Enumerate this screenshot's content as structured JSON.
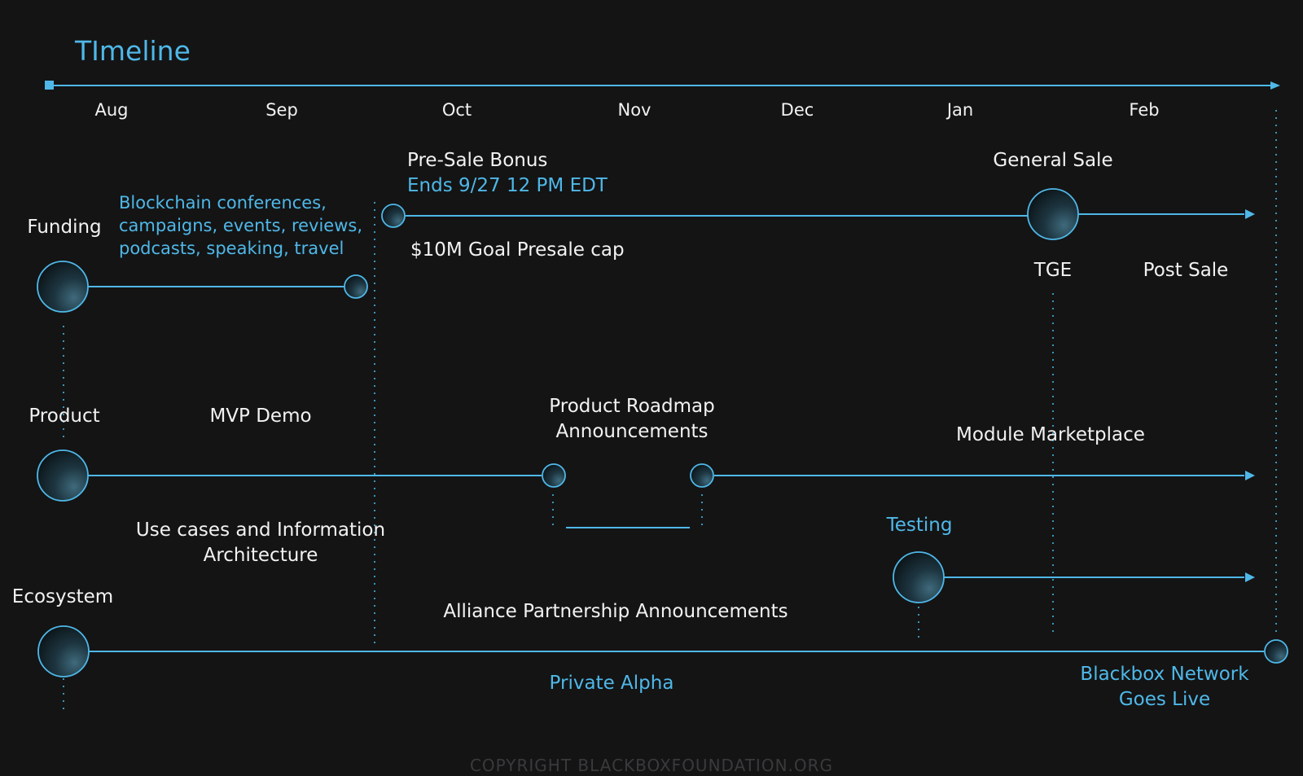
{
  "title": "TImeline",
  "months": [
    "Aug",
    "Sep",
    "Oct",
    "Nov",
    "Dec",
    "Jan",
    "Feb"
  ],
  "tracks": {
    "funding": "Funding",
    "product": "Product",
    "ecosystem": "Ecosystem"
  },
  "funding": {
    "marketing": [
      "Blockchain conferences,",
      "campaigns, events, reviews,",
      "podcasts, speaking, travel"
    ],
    "presale_title": "Pre-Sale Bonus",
    "presale_ends": "Ends 9/27 12 PM EDT",
    "presale_goal": "$10M Goal Presale cap",
    "general_sale": "General Sale",
    "tge": "TGE",
    "post_sale": "Post Sale"
  },
  "product": {
    "mvp_demo": "MVP Demo",
    "roadmap": [
      "Product Roadmap",
      "Announcements"
    ],
    "module_marketplace": "Module Marketplace",
    "use_cases": [
      "Use cases and Information",
      "Architecture"
    ],
    "testing": "Testing"
  },
  "ecosystem": {
    "alliance": "Alliance Partnership Announcements",
    "private_alpha": "Private Alpha",
    "network_live": [
      "Blackbox Network",
      "Goes Live"
    ]
  },
  "footer": "COPYRIGHT BLACKBOXFOUNDATION.ORG",
  "colors": {
    "background": "#141415",
    "accent": "#4fb8e8",
    "text": "#f2f2f2",
    "footer": "#3a3a3c"
  }
}
